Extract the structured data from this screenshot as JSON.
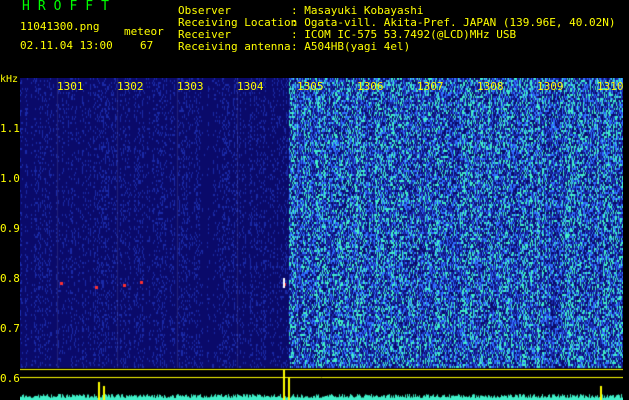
{
  "app": {
    "title": "HROFFT",
    "filename": "11041300.png",
    "datetime": "02.11.04 13:00",
    "counter_label": "meteor",
    "counter_value": "67"
  },
  "station": [
    {
      "label": "Observer",
      "value": ": Masayuki Kobayashi"
    },
    {
      "label": "Receiving Location",
      "value": ": Ogata-vill. Akita-Pref. JAPAN (139.96E, 40.02N)"
    },
    {
      "label": "Receiver",
      "value": ": ICOM IC-575 53.7492(@LCD)MHz USB"
    },
    {
      "label": "Receiving antenna",
      "value": ": A504HB(yagi 4el)"
    }
  ],
  "spectrogram": {
    "y_unit": "kHz",
    "y_ticks": [
      "1.1",
      "1.0",
      "0.9",
      "0.8",
      "0.7",
      "0.6"
    ],
    "x_ticks": [
      "1301",
      "1302",
      "1303",
      "1304",
      "1305",
      "1306",
      "1307",
      "1308",
      "1309",
      "1310"
    ],
    "colors": {
      "background": "#0a0a6a",
      "noise_low": "#1a2aa8",
      "noise_mid": "#2f6fff",
      "noise_high": "#3ff0c8",
      "meteor": "#ff3030",
      "axis": "#ffff00"
    }
  }
}
